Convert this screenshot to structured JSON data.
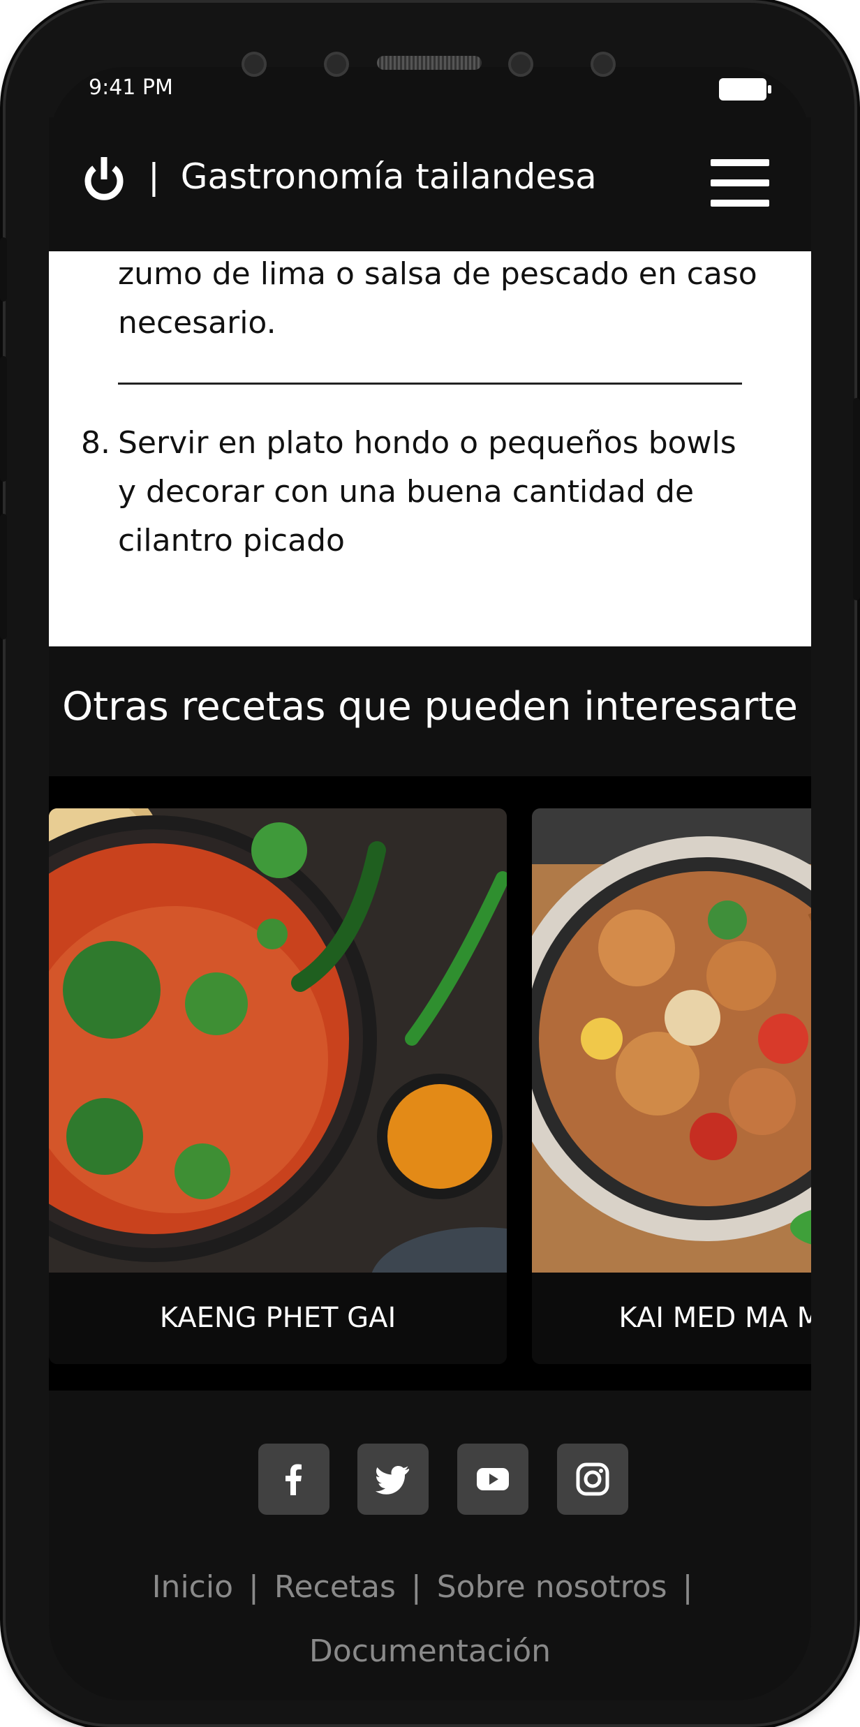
{
  "status_bar": {
    "time": "9:41 PM"
  },
  "header": {
    "title": "Gastronomía tailandesa",
    "separator": "|"
  },
  "recipe": {
    "step7_tail_line1": "zumo de lima o salsa de pescado en caso",
    "step7_tail_line2": "necesario.",
    "step8_number": "8.",
    "step8_line1": "Servir en plato hondo o pequeños bowls",
    "step8_line2": "y decorar con una buena cantidad de",
    "step8_line3": "cilantro picado"
  },
  "related": {
    "title": "Otras recetas que pueden interesarte",
    "cards": [
      {
        "label": "KAENG PHET GAI"
      },
      {
        "label": "KAI MED MA MUANG"
      }
    ]
  },
  "social": [
    "facebook-icon",
    "twitter-icon",
    "youtube-icon",
    "instagram-icon"
  ],
  "footer": {
    "links": [
      "Inicio",
      "Recetas",
      "Sobre nosotros",
      "Documentación"
    ],
    "separator": "|"
  }
}
